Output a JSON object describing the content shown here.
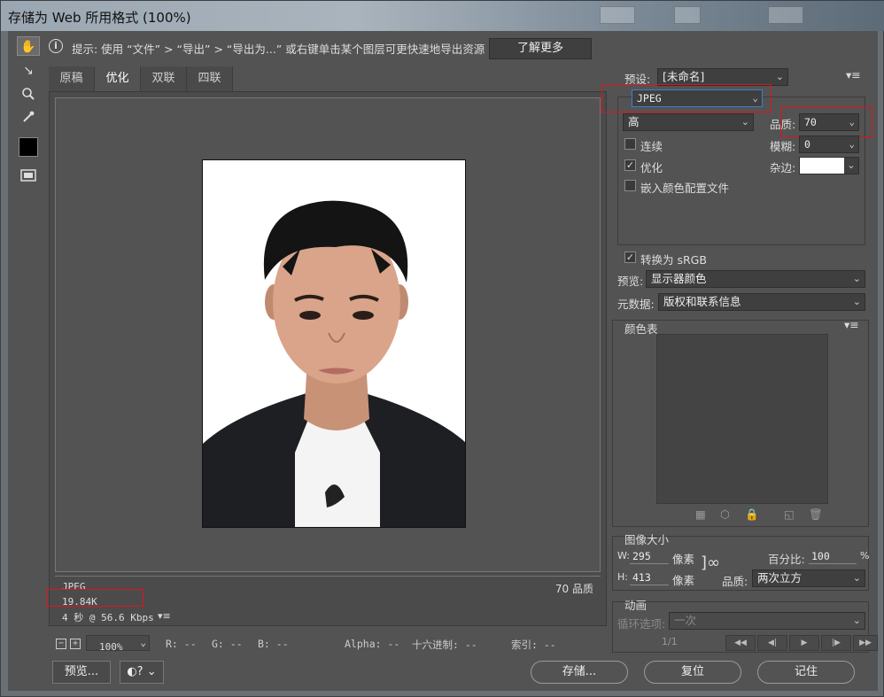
{
  "window": {
    "title": "存储为 Web 所用格式 (100%)"
  },
  "hint": {
    "icon": "info-icon",
    "text": "提示: 使用 “文件” > “导出” > “导出为...” 或右键单击某个图层可更快速地导出资源",
    "learn_more": "了解更多"
  },
  "tools": [
    {
      "name": "hand-icon",
      "glyph": "✋"
    },
    {
      "name": "slice-select-icon",
      "glyph": "⤡"
    },
    {
      "name": "zoom-icon",
      "glyph": "🔍"
    },
    {
      "name": "eyedropper-icon",
      "glyph": "⟋"
    }
  ],
  "tabs": [
    "原稿",
    "优化",
    "双联",
    "四联"
  ],
  "image_info": {
    "format": "JPEG",
    "size": "19.84K",
    "time": "4 秒 @ 56.6 Kbps",
    "quality": "70 品质"
  },
  "status": {
    "zoom": "100%",
    "r": "R: --",
    "g": "G: --",
    "b": "B: --",
    "alpha": "Alpha: --",
    "hex": "十六进制: --",
    "index": "索引: --"
  },
  "buttons": {
    "preview": "预览...",
    "save": "存储...",
    "reset": "复位",
    "remember": "记住"
  },
  "settings": {
    "preset_label": "预设:",
    "preset_value": "[未命名]",
    "format": "JPEG",
    "quality_level": "高",
    "quality_label": "品质:",
    "quality_value": "70",
    "progressive": "连续",
    "blur_label": "模糊:",
    "blur_value": "0",
    "optimized": "优化",
    "matte_label": "杂边:",
    "embed_profile": "嵌入颜色配置文件",
    "convert_srgb": "转换为 sRGB",
    "preview_label": "预览:",
    "preview_value": "显示器颜色",
    "metadata_label": "元数据:",
    "metadata_value": "版权和联系信息"
  },
  "color_table": {
    "title": "颜色表"
  },
  "image_size": {
    "title": "图像大小",
    "w_label": "W:",
    "w_value": "295",
    "h_label": "H:",
    "h_value": "413",
    "unit": "像素",
    "percent_label": "百分比:",
    "percent_value": "100",
    "percent_unit": "%",
    "quality_label": "品质:",
    "quality_value": "两次立方"
  },
  "animation": {
    "title": "动画",
    "loop_label": "循环选项:",
    "loop_value": "一次",
    "frame": "1/1"
  },
  "colors": {
    "highlight_red": "#e0141a",
    "format_border": "#3b7fd1"
  }
}
